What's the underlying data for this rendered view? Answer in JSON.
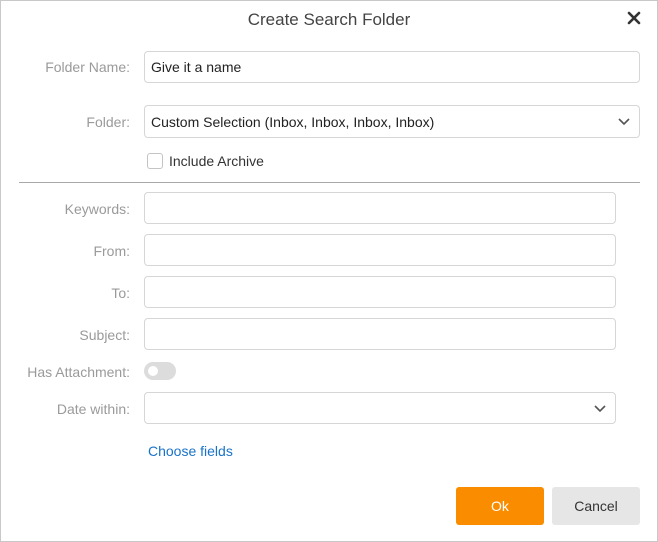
{
  "dialog": {
    "title": "Create Search Folder",
    "close_icon": "close-icon"
  },
  "folder_name": {
    "label": "Folder Name:",
    "value": "Give it a name"
  },
  "folder": {
    "label": "Folder:",
    "selected": "Custom Selection (Inbox, Inbox, Inbox, Inbox)"
  },
  "include_archive": {
    "label": "Include Archive",
    "checked": false
  },
  "keywords": {
    "label": "Keywords:",
    "value": ""
  },
  "from": {
    "label": "From:",
    "value": ""
  },
  "to": {
    "label": "To:",
    "value": ""
  },
  "subject": {
    "label": "Subject:",
    "value": ""
  },
  "has_attachment": {
    "label": "Has Attachment:",
    "on": false
  },
  "date_within": {
    "label": "Date within:",
    "selected": ""
  },
  "choose_fields": "Choose fields",
  "buttons": {
    "ok": "Ok",
    "cancel": "Cancel"
  },
  "colors": {
    "accent": "#fa8c00",
    "link": "#1a73c8"
  }
}
